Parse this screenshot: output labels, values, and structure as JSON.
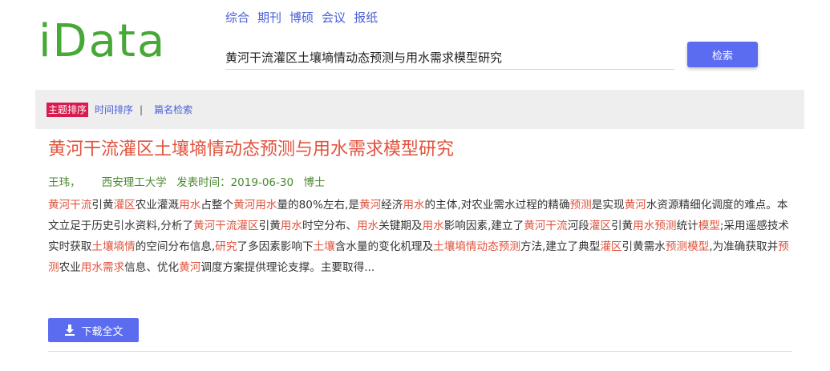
{
  "logo": {
    "text": "iData"
  },
  "nav": {
    "items": [
      "综合",
      "期刊",
      "博硕",
      "会议",
      "报纸"
    ]
  },
  "search": {
    "value": "黄河干流灌区土壤墒情动态预测与用水需求模型研究",
    "button_label": "检索"
  },
  "sort_bar": {
    "active": "主题排序",
    "time_sort": "时间排序",
    "separator": "|",
    "title_search": "篇名检索"
  },
  "result": {
    "title": "黄河干流灌区土壤墒情动态预测与用水需求模型研究",
    "author": "王玮，",
    "institution": "西安理工大学",
    "date_label": "发表时间：",
    "date": "2019-06-30",
    "degree": "博士",
    "abstract_segments": [
      {
        "t": "黄河干流",
        "h": true
      },
      {
        "t": "引黄",
        "h": false
      },
      {
        "t": "灌区",
        "h": true
      },
      {
        "t": "农业灌溉",
        "h": false
      },
      {
        "t": "用水",
        "h": true
      },
      {
        "t": "占整个",
        "h": false
      },
      {
        "t": "黄河用水",
        "h": true
      },
      {
        "t": "量的80%左右,是",
        "h": false
      },
      {
        "t": "黄河",
        "h": true
      },
      {
        "t": "经济",
        "h": false
      },
      {
        "t": "用水",
        "h": true
      },
      {
        "t": "的主体,对农业需水过程的精确",
        "h": false
      },
      {
        "t": "预测",
        "h": true
      },
      {
        "t": "是实现",
        "h": false
      },
      {
        "t": "黄河",
        "h": true
      },
      {
        "t": "水资源精细化调度的难点。本文立足于历史引水资料,分析了",
        "h": false
      },
      {
        "t": "黄河干流灌区",
        "h": true
      },
      {
        "t": "引黄",
        "h": false
      },
      {
        "t": "用水",
        "h": true
      },
      {
        "t": "时空分布、",
        "h": false
      },
      {
        "t": "用水",
        "h": true
      },
      {
        "t": "关键期及",
        "h": false
      },
      {
        "t": "用水",
        "h": true
      },
      {
        "t": "影响因素,建立了",
        "h": false
      },
      {
        "t": "黄河干流",
        "h": true
      },
      {
        "t": "河段",
        "h": false
      },
      {
        "t": "灌区",
        "h": true
      },
      {
        "t": "引黄",
        "h": false
      },
      {
        "t": "用水预测",
        "h": true
      },
      {
        "t": "统计",
        "h": false
      },
      {
        "t": "模型",
        "h": true
      },
      {
        "t": ";采用遥感技术实时获取",
        "h": false
      },
      {
        "t": "土壤墒情",
        "h": true
      },
      {
        "t": "的空间分布信息,",
        "h": false
      },
      {
        "t": "研究",
        "h": true
      },
      {
        "t": "了多因素影响下",
        "h": false
      },
      {
        "t": "土壤",
        "h": true
      },
      {
        "t": "含水量的变化机理及",
        "h": false
      },
      {
        "t": "土壤墒情动态预测",
        "h": true
      },
      {
        "t": "方法,建立了典型",
        "h": false
      },
      {
        "t": "灌区",
        "h": true
      },
      {
        "t": "引黄需水",
        "h": false
      },
      {
        "t": "预测模型",
        "h": true
      },
      {
        "t": ",为准确获取并",
        "h": false
      },
      {
        "t": "预测",
        "h": true
      },
      {
        "t": "农业",
        "h": false
      },
      {
        "t": "用水需求",
        "h": true
      },
      {
        "t": "信息、优化",
        "h": false
      },
      {
        "t": "黄河",
        "h": true
      },
      {
        "t": "调度方案提供理论支撑。主要取得...",
        "h": false
      }
    ],
    "download_label": "下载全文"
  },
  "colors": {
    "logo": "#47a838",
    "link": "#4a60d8",
    "button": "#5b6cf0",
    "highlight": "#e0533d",
    "meta": "#4b8b2f",
    "sort_active": "#d81b4f"
  }
}
